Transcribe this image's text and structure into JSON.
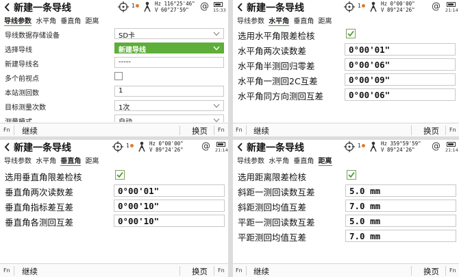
{
  "common": {
    "title": "新建一条导线",
    "tabs": [
      "导线参数",
      "水平角",
      "垂直角",
      "距离"
    ],
    "face_label": "1",
    "footer": {
      "fn_left": "Fn",
      "continue_label": "继续",
      "page_label": "换页",
      "fn_right": "Fn"
    }
  },
  "panel1": {
    "hz": "Hz 116°25'46\"",
    "v": "V   60°27'59\"",
    "clock": "15:33",
    "active_tab": 0,
    "rows": [
      {
        "label": "导线数据存储设备",
        "value": "SD卡"
      },
      {
        "label": "选择导线",
        "value": "新建导线"
      },
      {
        "label": "新建导线名",
        "value": "-----"
      },
      {
        "label": "多个前视点",
        "value": ""
      },
      {
        "label": "本站测回数",
        "value": "1"
      },
      {
        "label": "目标测量次数",
        "value": "1次"
      },
      {
        "label": "测量模式",
        "value": "自动"
      }
    ]
  },
  "panel2": {
    "hz": "Hz  0°00'00\"",
    "v": "V   89°24'26\"",
    "clock": "21:14",
    "active_tab": 1,
    "check_label": "选用水平角限差检核",
    "rows": [
      {
        "label": "水平角两次读数差",
        "value": "0°00'01\""
      },
      {
        "label": "水平角半测回归零差",
        "value": "0°00'06\""
      },
      {
        "label": "水平角一测回2C互差",
        "value": "0°00'09\""
      },
      {
        "label": "水平角同方向测回互差",
        "value": "0°00'06\""
      }
    ]
  },
  "panel3": {
    "hz": "Hz  0°00'00\"",
    "v": "V   89°24'26\"",
    "clock": "21:14",
    "active_tab": 2,
    "check_label": "选用垂直角限差检核",
    "rows": [
      {
        "label": "垂直角两次读数差",
        "value": "0°00'01\""
      },
      {
        "label": "垂直角指标差互差",
        "value": "0°00'10\""
      },
      {
        "label": "垂直角各测回互差",
        "value": "0°00'10\""
      }
    ]
  },
  "panel4": {
    "hz": "Hz 359°59'59\"",
    "v": "V   89°24'26\"",
    "clock": "21:14",
    "active_tab": 3,
    "check_label": "选用距离限差检核",
    "rows": [
      {
        "label": "斜距一测回读数互差",
        "value": "5.0 mm"
      },
      {
        "label": "斜距测回均值互差",
        "value": "7.0 mm"
      },
      {
        "label": "平距一测回读数互差",
        "value": "5.0 mm"
      },
      {
        "label": "平距测回均值互差",
        "value": "7.0 mm"
      }
    ]
  },
  "colors": {
    "accent_green": "#5eae3a",
    "check_green": "#4a9c2a"
  },
  "icons": [
    "back-arrow-icon",
    "target-icon",
    "face-icon",
    "person-icon",
    "at-icon",
    "battery-icon",
    "dropdown-icon",
    "checkmark-icon"
  ]
}
